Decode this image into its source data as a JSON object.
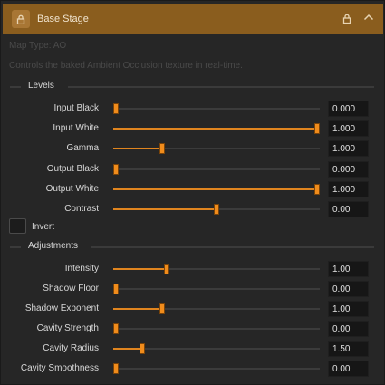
{
  "header": {
    "title": "Base Stage"
  },
  "meta": {
    "map_type": "Map Type: AO",
    "description": "Controls the baked Ambient Occlusion texture in real-time."
  },
  "levels": {
    "title": "Levels",
    "rows": [
      {
        "label": "Input Black",
        "value": "0.000",
        "fraction": 0.0
      },
      {
        "label": "Input White",
        "value": "1.000",
        "fraction": 1.0
      },
      {
        "label": "Gamma",
        "value": "1.000",
        "fraction": 0.23
      },
      {
        "label": "Output Black",
        "value": "0.000",
        "fraction": 0.0
      },
      {
        "label": "Output White",
        "value": "1.000",
        "fraction": 1.0
      },
      {
        "label": "Contrast",
        "value": "0.00",
        "fraction": 0.5
      }
    ]
  },
  "invert": {
    "label": "Invert",
    "checked": false
  },
  "adjustments": {
    "title": "Adjustments",
    "rows": [
      {
        "label": "Intensity",
        "value": "1.00",
        "fraction": 0.25
      },
      {
        "label": "Shadow Floor",
        "value": "0.00",
        "fraction": 0.0
      },
      {
        "label": "Shadow Exponent",
        "value": "1.00",
        "fraction": 0.23
      },
      {
        "label": "Cavity Strength",
        "value": "0.00",
        "fraction": 0.0
      },
      {
        "label": "Cavity Radius",
        "value": "1.50",
        "fraction": 0.13
      },
      {
        "label": "Cavity Smoothness",
        "value": "0.00",
        "fraction": 0.0
      }
    ]
  },
  "icons": {
    "lock": "lock-icon",
    "collapse": "chevron-up-icon"
  },
  "colors": {
    "accent": "#f08c1c",
    "header": "#8a5d1e",
    "panel": "#262626"
  }
}
